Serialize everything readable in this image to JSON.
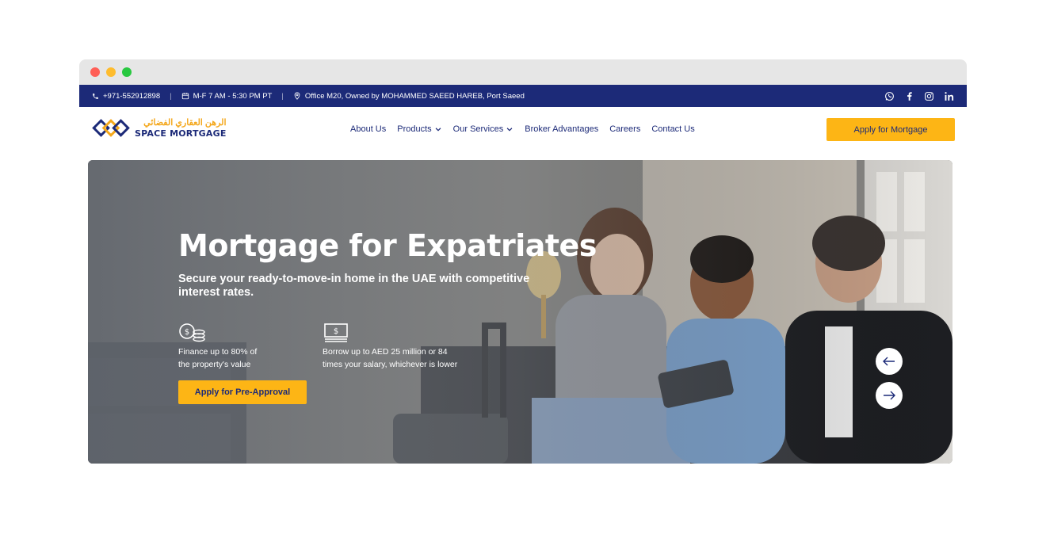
{
  "topbar": {
    "phone": "+971-552912898",
    "hours": "M-F 7 AM - 5:30 PM PT",
    "address": "Office M20, Owned by MOHAMMED SAEED HAREB, Port Saeed",
    "separator": "|",
    "social": [
      "whatsapp-icon",
      "facebook-icon",
      "instagram-icon",
      "linkedin-icon"
    ]
  },
  "logo": {
    "arabic": "الرهن العقاري الفضائي",
    "english": "SPACE MORTGAGE"
  },
  "nav": {
    "items": [
      {
        "label": "About Us",
        "dropdown": false
      },
      {
        "label": "Products",
        "dropdown": true
      },
      {
        "label": "Our Services",
        "dropdown": true
      },
      {
        "label": "Broker Advantages",
        "dropdown": false
      },
      {
        "label": "Careers",
        "dropdown": false
      },
      {
        "label": "Contact Us",
        "dropdown": false
      }
    ],
    "cta": "Apply for Mortgage"
  },
  "hero": {
    "title": "Mortgage for Expatriates",
    "subtitle": "Secure your ready-to-move-in home in the UAE with competitive interest rates.",
    "features": [
      {
        "icon": "coins-icon",
        "line1": "Finance up to 80% of",
        "line2": "the property's value"
      },
      {
        "icon": "cash-icon",
        "line1": "Borrow up to AED 25 million or 84",
        "line2": "times your salary, whichever is lower"
      }
    ],
    "cta": "Apply for Pre-Approval",
    "prev_arrow": "←",
    "next_arrow": "→"
  },
  "colors": {
    "navy": "#1c2a78",
    "accent": "#fdb515"
  }
}
